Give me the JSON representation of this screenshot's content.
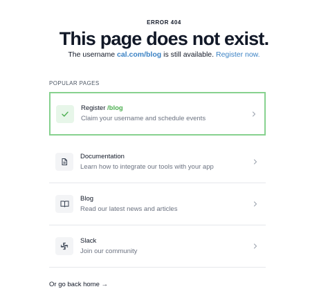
{
  "error": {
    "code": "ERROR 404",
    "headline": "This page does not exist.",
    "sub_prefix": "The username",
    "sub_path": "cal.com/blog",
    "sub_middle": "is still available.",
    "sub_link": "Register now."
  },
  "popular": {
    "label": "POPULAR PAGES",
    "items": [
      {
        "title": "Register",
        "title_accent": "/blog",
        "desc": "Claim your username and schedule events",
        "icon": "check-icon"
      },
      {
        "title": "Documentation",
        "desc": "Learn how to integrate our tools with your app",
        "icon": "document-icon"
      },
      {
        "title": "Blog",
        "desc": "Read our latest news and articles",
        "icon": "book-open-icon"
      },
      {
        "title": "Slack",
        "desc": "Join our community",
        "icon": "slack-icon"
      }
    ]
  },
  "footer": {
    "back_home": "Or go back home →"
  },
  "colors": {
    "accent_green": "#4caf50",
    "highlight_border": "#86d18e",
    "link_blue": "#3b82c4"
  }
}
